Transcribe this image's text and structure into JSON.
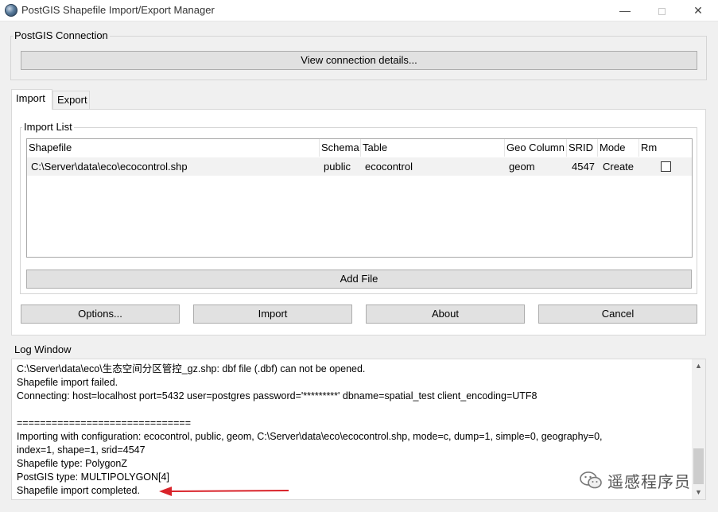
{
  "window": {
    "title": "PostGIS Shapefile Import/Export Manager",
    "minimize": "—",
    "close": "✕"
  },
  "connection": {
    "group_label": "PostGIS Connection",
    "view_button": "View connection details..."
  },
  "tabs": [
    {
      "label": "Import",
      "active": true
    },
    {
      "label": "Export",
      "active": false
    }
  ],
  "import_list": {
    "group_label": "Import List",
    "columns": [
      "Shapefile",
      "Schema",
      "Table",
      "Geo Column",
      "SRID",
      "Mode",
      "Rm"
    ],
    "rows": [
      {
        "shapefile": "C:\\Server\\data\\eco\\ecocontrol.shp",
        "schema": "public",
        "table": "ecocontrol",
        "geo_column": "geom",
        "srid": "4547",
        "mode": "Create",
        "rm": false
      }
    ],
    "add_file": "Add File"
  },
  "buttons": {
    "options": "Options...",
    "import": "Import",
    "about": "About",
    "cancel": "Cancel"
  },
  "log": {
    "group_label": "Log Window",
    "lines": [
      "C:\\Server\\data\\eco\\生态空间分区管控_gz.shp: dbf file (.dbf) can not be opened.",
      "Shapefile import failed.",
      "Connecting:  host=localhost port=5432 user=postgres password='*********' dbname=spatial_test client_encoding=UTF8",
      "",
      "==============================",
      "Importing with configuration: ecocontrol, public, geom, C:\\Server\\data\\eco\\ecocontrol.shp, mode=c, dump=1, simple=0, geography=0,",
      "index=1, shape=1, srid=4547",
      "Shapefile type: PolygonZ",
      "PostGIS type: MULTIPOLYGON[4]",
      "Shapefile import completed."
    ]
  },
  "watermark": {
    "text": "遥感程序员"
  },
  "colors": {
    "arrow": "#d9232a",
    "button_bg": "#e1e1e1",
    "window_bg": "#f0f0f0"
  }
}
